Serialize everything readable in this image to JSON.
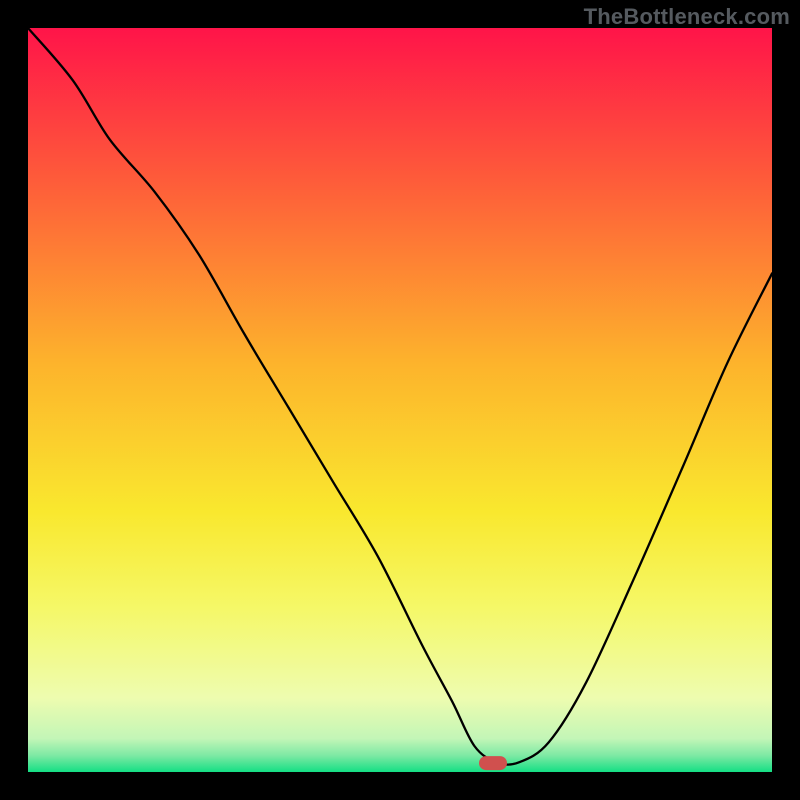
{
  "watermark": "TheBottleneck.com",
  "chart_data": {
    "type": "line",
    "title": "",
    "xlabel": "",
    "ylabel": "",
    "xlim": [
      0,
      100
    ],
    "ylim": [
      0,
      100
    ],
    "grid": false,
    "legend": false,
    "gradient_stops": [
      {
        "offset": 0,
        "color": "#ff1449"
      },
      {
        "offset": 0.2,
        "color": "#fe5a3a"
      },
      {
        "offset": 0.45,
        "color": "#fdb32c"
      },
      {
        "offset": 0.65,
        "color": "#f9e82e"
      },
      {
        "offset": 0.78,
        "color": "#f5f868"
      },
      {
        "offset": 0.9,
        "color": "#eefcaf"
      },
      {
        "offset": 0.955,
        "color": "#c3f6b7"
      },
      {
        "offset": 0.978,
        "color": "#7de9a4"
      },
      {
        "offset": 1.0,
        "color": "#14df84"
      }
    ],
    "marker": {
      "x": 62.5,
      "y": 1.2,
      "color": "#d0504e"
    },
    "series": [
      {
        "name": "bottleneck-curve",
        "x": [
          0,
          6,
          11,
          17,
          23,
          29,
          35,
          41,
          47,
          53,
          57,
          60,
          63,
          66,
          70,
          75,
          81,
          88,
          94,
          100
        ],
        "y": [
          100,
          93,
          85,
          78,
          69.5,
          59,
          49,
          39,
          29,
          17,
          9.5,
          3.5,
          1.3,
          1.3,
          4,
          12,
          25,
          41,
          55,
          67
        ],
        "stroke": "#000000",
        "stroke_width": 2.3
      }
    ]
  }
}
